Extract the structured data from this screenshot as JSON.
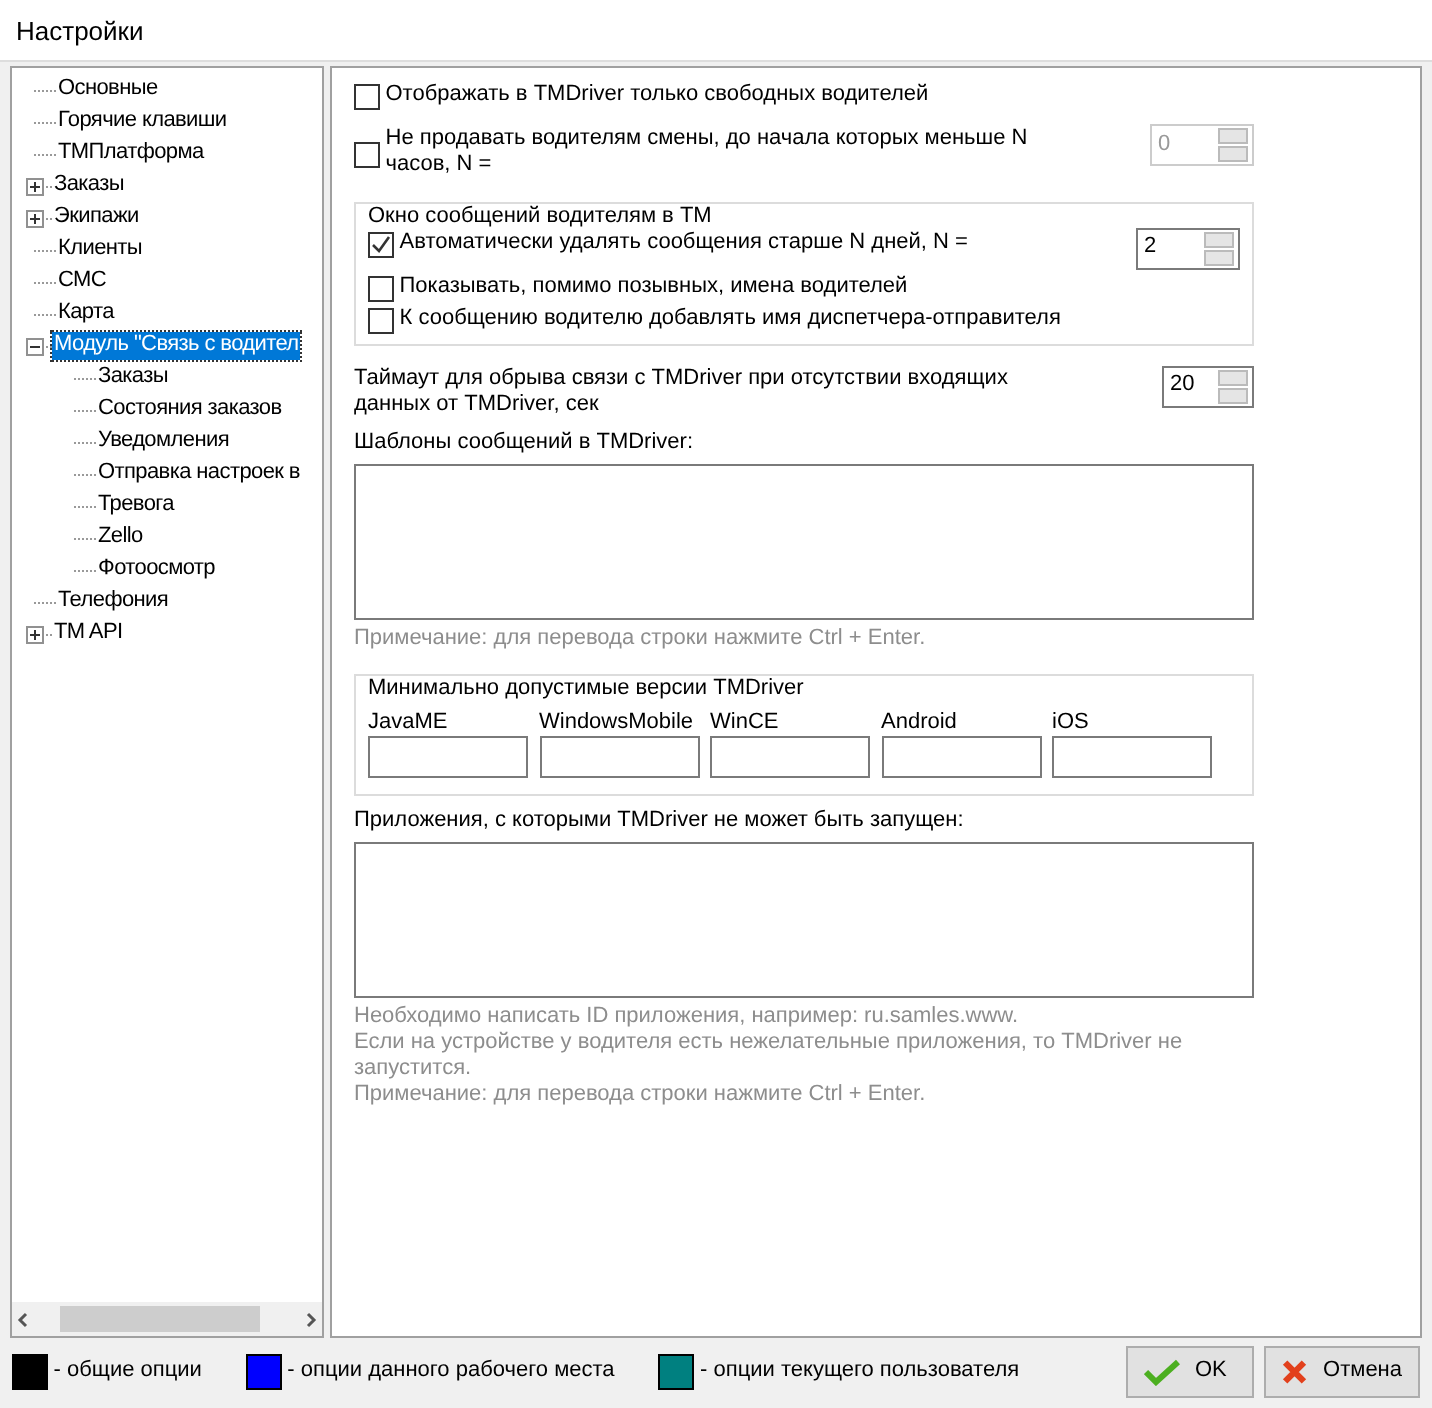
{
  "window": {
    "title": "Настройки"
  },
  "tree": [
    {
      "label": "Основные",
      "selected": false
    },
    {
      "label": "Горячие клавиши",
      "selected": false
    },
    {
      "label": "ТМПлатформа",
      "selected": false
    },
    {
      "label": "Заказы",
      "selected": false,
      "expanded": false
    },
    {
      "label": "Экипажи",
      "selected": false,
      "expanded": false
    },
    {
      "label": "Клиенты",
      "selected": false
    },
    {
      "label": "СМС",
      "selected": false
    },
    {
      "label": "Карта",
      "selected": false
    },
    {
      "label": "Модуль \"Связь с водител",
      "selected": true,
      "expanded": true,
      "children": [
        {
          "label": "Заказы",
          "selected": false
        },
        {
          "label": "Состояния заказов",
          "selected": false
        },
        {
          "label": "Уведомления",
          "selected": false
        },
        {
          "label": "Отправка настроек в",
          "selected": false
        },
        {
          "label": "Тревога",
          "selected": false
        },
        {
          "label": "Zello",
          "selected": false
        },
        {
          "label": "Фотоосмотр",
          "selected": false
        }
      ]
    },
    {
      "label": "Телефония",
      "selected": false
    },
    {
      "label": "TM API",
      "selected": false,
      "expanded": false
    }
  ],
  "options": [
    {
      "label": "Отображать в TMDriver только свободных водителей",
      "checked": false
    },
    {
      "label": "Не продавать водителям смены, до начала которых меньше N часов, N =",
      "checked": false,
      "spinner": {
        "value": "0",
        "disabled": true
      }
    }
  ],
  "message_group": {
    "title": "Окно сообщений водителям в ТМ",
    "options": [
      {
        "label": "Автоматически удалять сообщения старше N дней, N =",
        "checked": true,
        "spinner": {
          "value": "2",
          "disabled": false
        }
      },
      {
        "label": "Показывать, помимо позывных, имена водителей",
        "checked": false
      },
      {
        "label": "К сообщению водителю добавлять имя диспетчера-отправителя",
        "checked": false
      }
    ]
  },
  "timeout": {
    "label": "Таймаут для обрыва связи с TMDriver при отсутствии входящих данных от TMDriver, сек",
    "spinner": {
      "value": "20",
      "disabled": false
    }
  },
  "templates": {
    "label": "Шаблоны сообщений в TMDriver:",
    "notes": [
      "Примечание: для перевода строки нажмите Ctrl + Enter."
    ]
  },
  "versions": {
    "title": "Минимально допустимые версии TMDriver",
    "fields": [
      {
        "label": "JavaME"
      },
      {
        "label": "WindowsMobile"
      },
      {
        "label": "WinCE"
      },
      {
        "label": "Android"
      },
      {
        "label": "iOS"
      }
    ]
  },
  "blocked_apps": {
    "label": "Приложения, с которыми TMDriver не может быть запущен:",
    "notes": [
      "Необходимо написать ID приложения,  например: ru.samles.www.",
      "Если на устройстве у водителя есть нежелательные приложения,  то TMDriver не запустится.",
      "Примечание: для перевода строки нажмите Ctrl + Enter."
    ]
  },
  "legend": [
    {
      "color": "#000000",
      "label": "- общие опции"
    },
    {
      "color": "#0000ff",
      "label": "- опции данного рабочего места"
    },
    {
      "color": "#008080",
      "label": "- опции текущего пользователя"
    }
  ],
  "buttons": [
    {
      "label": "OK",
      "kind": "ok"
    },
    {
      "label": "Отмена",
      "kind": "cancel"
    }
  ]
}
